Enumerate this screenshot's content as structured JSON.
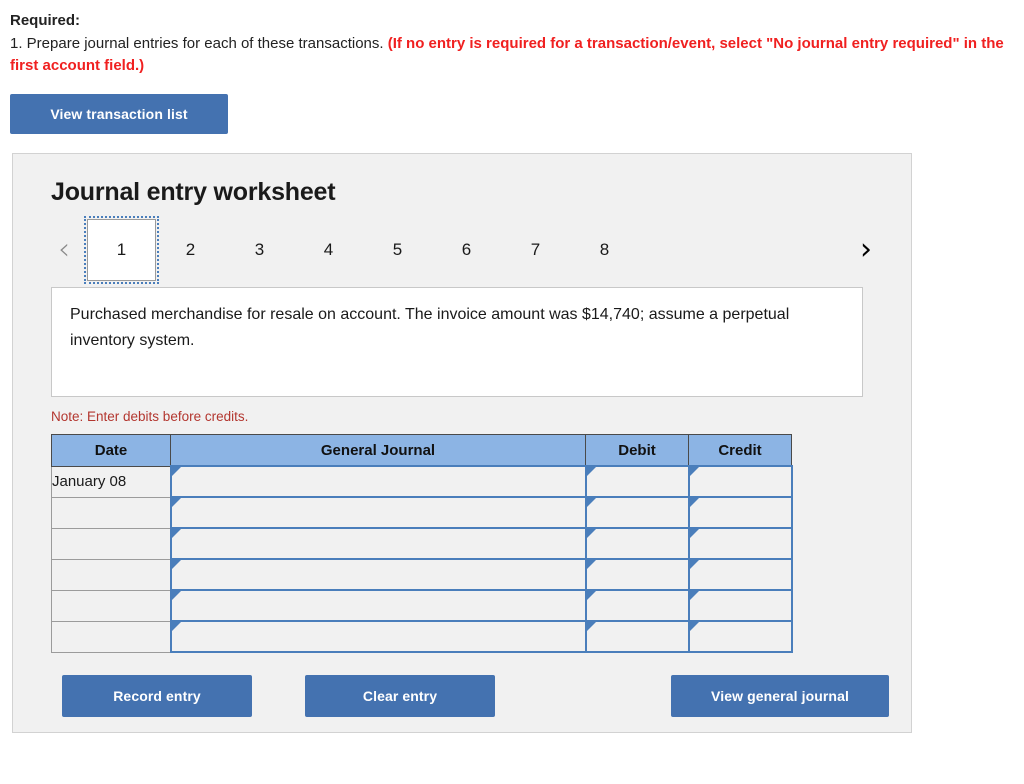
{
  "required": {
    "label": "Required:",
    "instruction": "1. Prepare journal entries for each of these transactions. ",
    "instruction_note": "(If no entry is required for a transaction/event, select \"No journal entry required\" in the first account field.)",
    "note_color": "#f02020"
  },
  "toolbar": {
    "view_transaction_list_label": "View transaction list"
  },
  "worksheet": {
    "title": "Journal entry worksheet",
    "pager": {
      "prev_icon": "chevron-left-icon",
      "prev_glyph": "‹",
      "next_icon": "chevron-right-icon",
      "next_glyph": "›",
      "prev_enabled": false,
      "next_enabled": true,
      "active_index": 0,
      "tabs": [
        "1",
        "2",
        "3",
        "4",
        "5",
        "6",
        "7",
        "8"
      ]
    },
    "transaction": {
      "description": "Purchased merchandise for resale on account. The invoice amount was $14,740; assume a perpetual inventory system."
    },
    "note": "Note: Enter debits before credits.",
    "table": {
      "headers": [
        "Date",
        "General Journal",
        "Debit",
        "Credit"
      ],
      "rows": [
        {
          "date": "January 08",
          "general_journal": "",
          "debit": "",
          "credit": ""
        },
        {
          "date": "",
          "general_journal": "",
          "debit": "",
          "credit": ""
        },
        {
          "date": "",
          "general_journal": "",
          "debit": "",
          "credit": ""
        },
        {
          "date": "",
          "general_journal": "",
          "debit": "",
          "credit": ""
        },
        {
          "date": "",
          "general_journal": "",
          "debit": "",
          "credit": ""
        },
        {
          "date": "",
          "general_journal": "",
          "debit": "",
          "credit": ""
        }
      ]
    },
    "actions": {
      "record_entry_label": "Record entry",
      "clear_entry_label": "Clear entry",
      "view_general_journal_label": "View general journal"
    }
  },
  "theme": {
    "button_blue": "#4472b0",
    "header_blue": "#8cb4e4",
    "cell_border_blue": "#4a7ebb",
    "panel_gray": "#f1f1f1",
    "note_red": "#b3362f",
    "alert_red": "#f02020"
  }
}
